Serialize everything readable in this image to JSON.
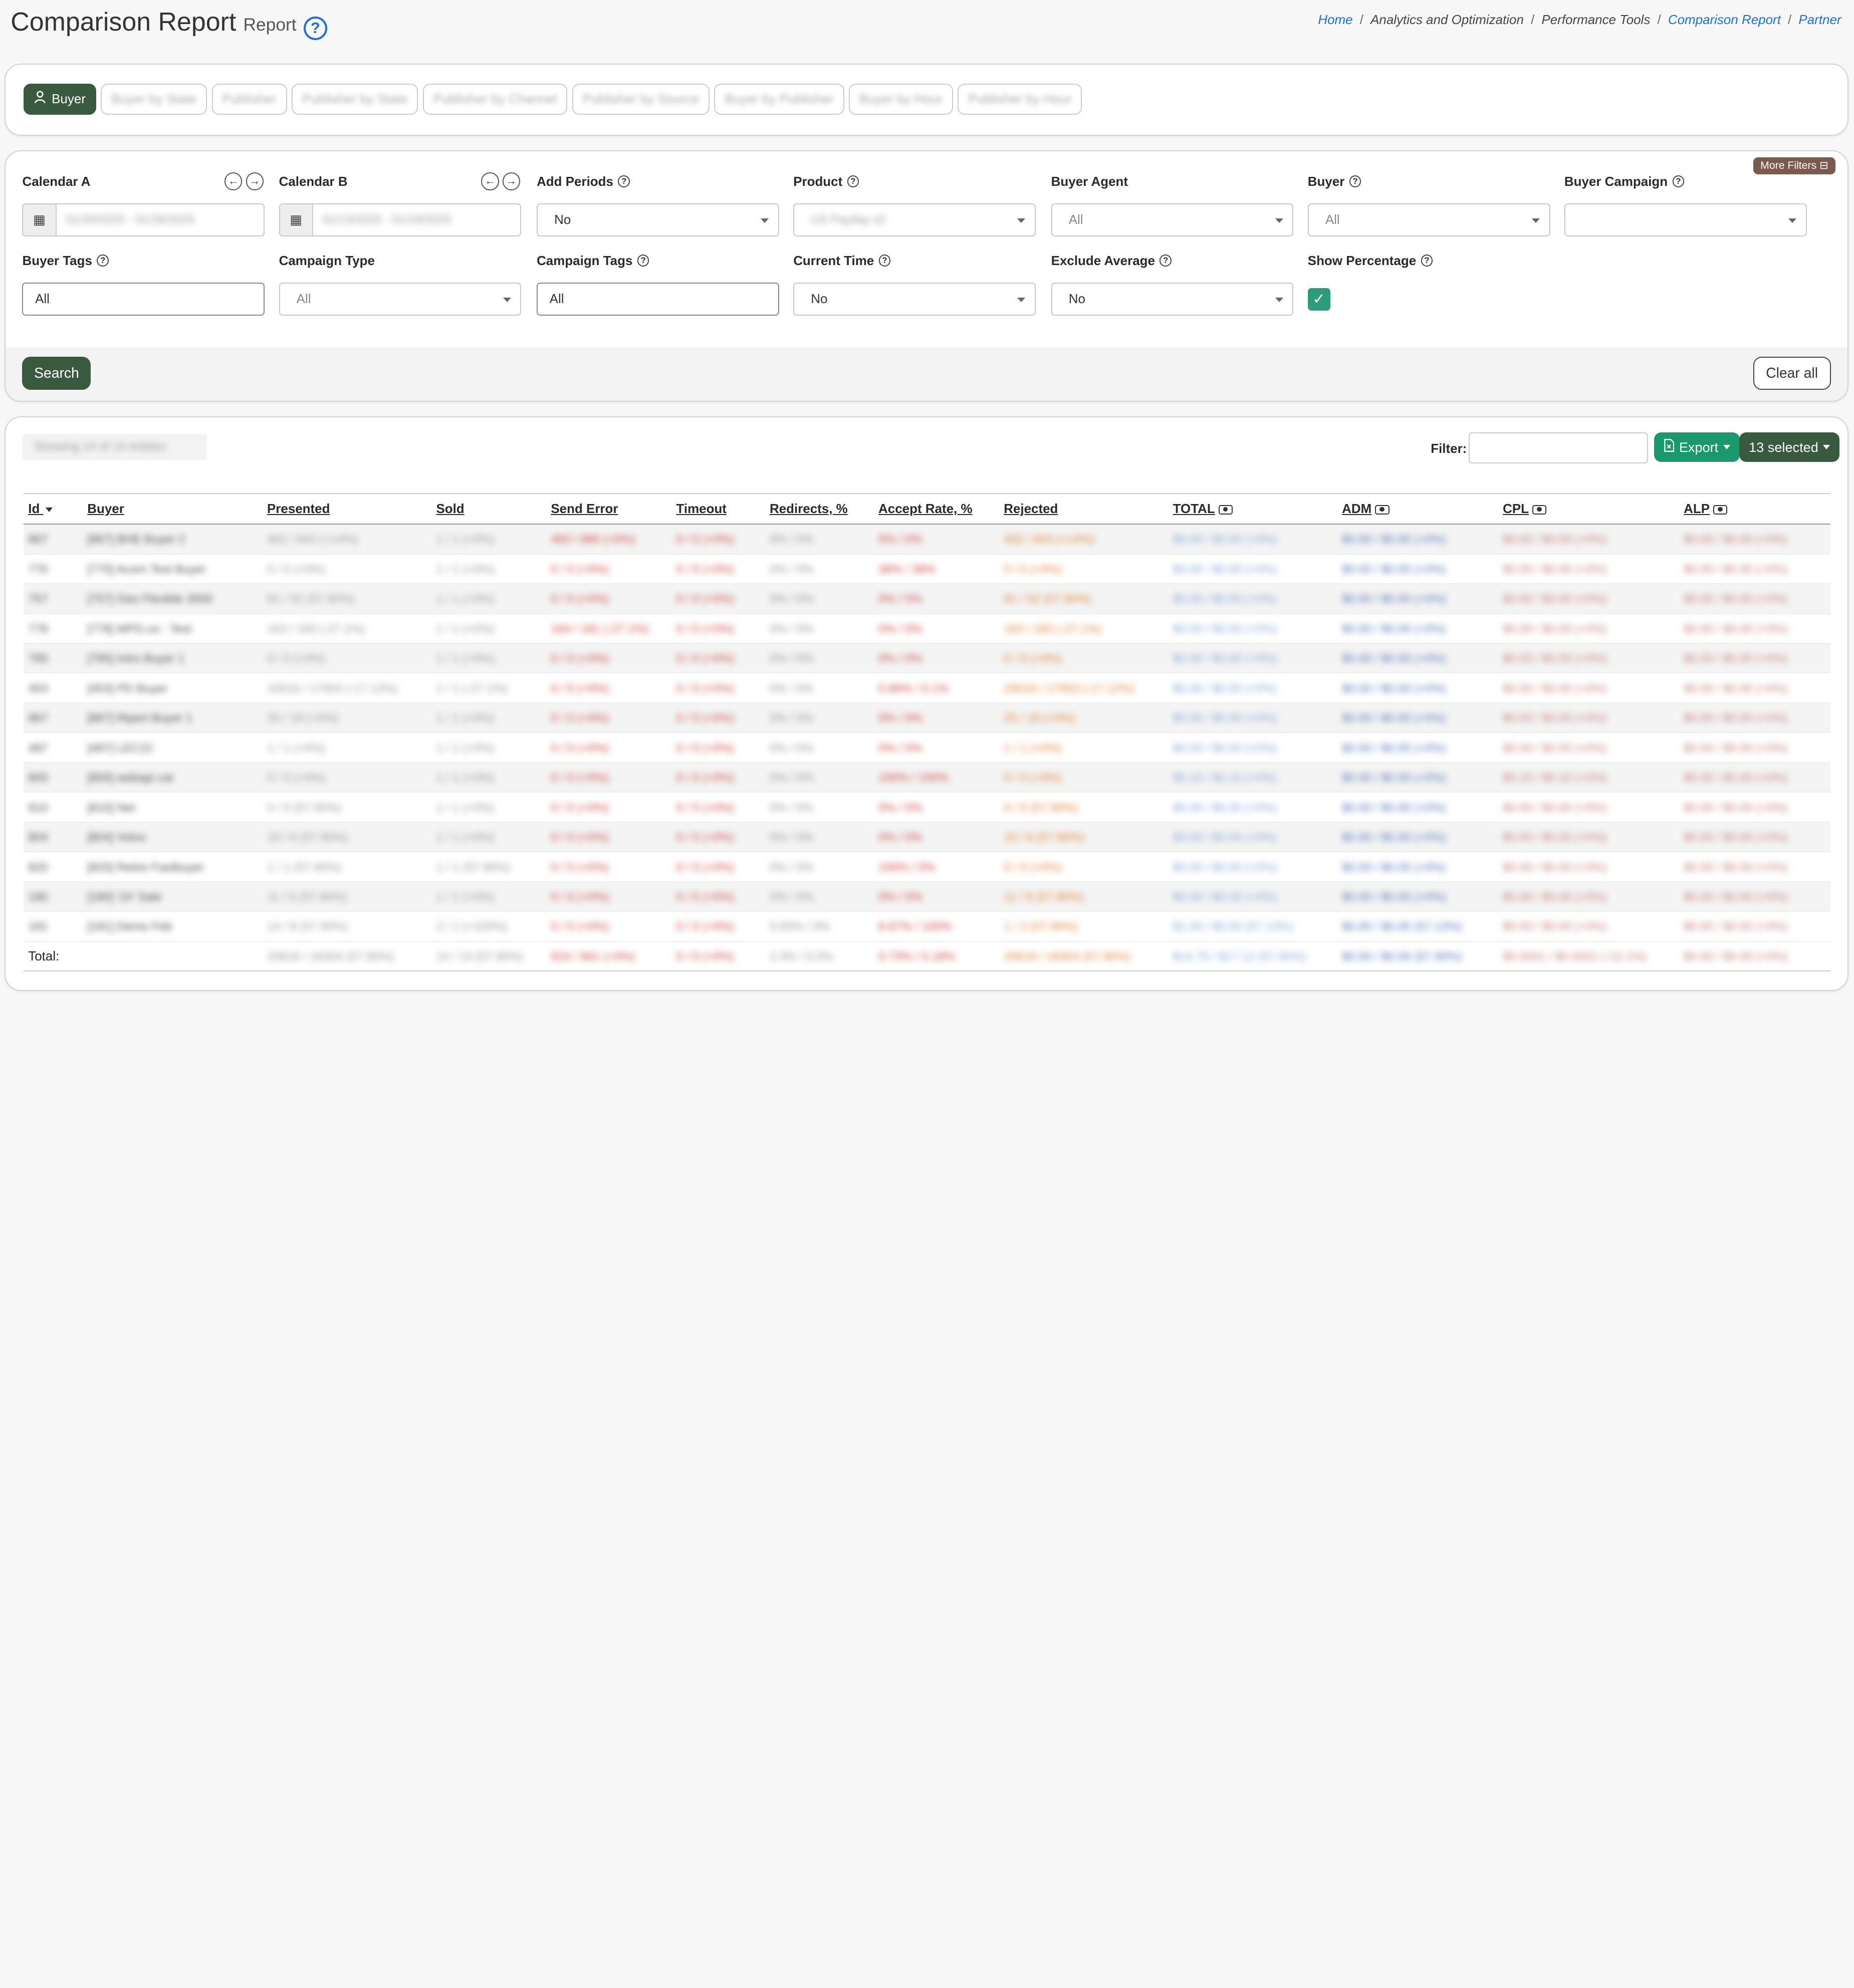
{
  "header": {
    "title": "Comparison Report",
    "subtitle": "Report",
    "help_glyph": "?"
  },
  "breadcrumb": {
    "items": [
      {
        "label": "Home",
        "link": true
      },
      {
        "label": "Analytics and Optimization",
        "link": false
      },
      {
        "label": "Performance Tools",
        "link": false
      },
      {
        "label": "Comparison Report",
        "link": true
      },
      {
        "label": "Partner",
        "link": true
      }
    ],
    "separator": "/"
  },
  "tabs": [
    {
      "label": "Buyer",
      "active": true,
      "icon": "user-icon"
    },
    {
      "label": "Buyer by State",
      "active": false
    },
    {
      "label": "Publisher",
      "active": false
    },
    {
      "label": "Publisher by State",
      "active": false
    },
    {
      "label": "Publisher by Channel",
      "active": false
    },
    {
      "label": "Publisher by Source",
      "active": false
    },
    {
      "label": "Buyer by Publisher",
      "active": false
    },
    {
      "label": "Buyer by Hour",
      "active": false
    },
    {
      "label": "Publisher by Hour",
      "active": false
    }
  ],
  "filters": {
    "more_filters": "More Filters",
    "calendar_a": {
      "label": "Calendar A",
      "value": "01/20/2025 - 01/26/2025"
    },
    "calendar_b": {
      "label": "Calendar B",
      "value": "01/13/2025 - 01/19/2025"
    },
    "add_periods": {
      "label": "Add Periods",
      "value": "No"
    },
    "product": {
      "label": "Product",
      "value": "US Payday v2"
    },
    "buyer_agent": {
      "label": "Buyer Agent",
      "value": "All"
    },
    "buyer": {
      "label": "Buyer",
      "value": "All"
    },
    "buyer_campaign": {
      "label": "Buyer Campaign",
      "value": ""
    },
    "buyer_tags": {
      "label": "Buyer Tags",
      "value": "All"
    },
    "campaign_type": {
      "label": "Campaign Type",
      "value": "All"
    },
    "campaign_tags": {
      "label": "Campaign Tags",
      "value": "All"
    },
    "current_time": {
      "label": "Current Time",
      "value": "No"
    },
    "exclude_average": {
      "label": "Exclude Average",
      "value": "No"
    },
    "show_percentage": {
      "label": "Show Percentage",
      "checked": true
    },
    "search_label": "Search",
    "clear_label": "Clear all"
  },
  "table_toolbar": {
    "showing": "Showing 14 of 14 entities",
    "filter_label": "Filter:",
    "export_label": "Export",
    "selected_label": "13 selected"
  },
  "table": {
    "columns": [
      "Id",
      "Buyer",
      "Presented",
      "Sold",
      "Send Error",
      "Timeout",
      "Redirects, %",
      "Accept Rate, %",
      "Rejected",
      "TOTAL",
      "ADM",
      "CPL",
      "ALP"
    ],
    "rows": [
      [
        "867",
        "[867] BHE Buyer 2",
        "462 / 843 (+14%)",
        "1 / 1 (+0%)",
        "460 / 880 (+0%)",
        "0 / 0 (+0%)",
        "0% / 0%",
        "0% / 0%",
        "452 / 843 (+14%)",
        "$0.00 / $0.00 (+0%)",
        "$0.00 / $0.00 (+0%)",
        "$0.00 / $0.00 (+0%)",
        "$0.00 / $0.00 (+0%)"
      ],
      [
        "770",
        "[770] Acorn Test Buyer",
        "0 / 0 (+0%)",
        "1 / 1 (+0%)",
        "0 / 0 (+0%)",
        "0 / 0 (+0%)",
        "0% / 0%",
        "38% / 38%",
        "0 / 0 (+0%)",
        "$0.00 / $0.00 (+0%)",
        "$0.00 / $0.00 (+0%)",
        "$0.00 / $0.00 (+0%)",
        "$0.00 / $0.00 (+0%)"
      ],
      [
        "757",
        "[757] Geo Flexible 3000",
        "81 / 52 (57.90%)",
        "1 / 1 (+0%)",
        "0 / 0 (+0%)",
        "0 / 0 (+0%)",
        "0% / 0%",
        "0% / 0%",
        "81 / 52 (57.90%)",
        "$0.00 / $0.00 (+0%)",
        "$0.00 / $0.00 (+0%)",
        "$0.00 / $0.00 (+0%)",
        "$0.00 / $0.00 (+0%)"
      ],
      [
        "778",
        "[778] MPG.co - Test",
        "163 / 183 (-27.1%)",
        "1 / 1 (+0%)",
        "164 / 181 (-27.1%)",
        "0 / 0 (+0%)",
        "0% / 0%",
        "0% / 0%",
        "163 / 183 (-27.1%)",
        "$0.00 / $0.00 (+0%)",
        "$0.00 / $0.00 (+0%)",
        "$0.00 / $0.00 (+0%)",
        "$0.00 / $0.00 (+0%)"
      ],
      [
        "785",
        "[785] Intro Buyer 1",
        "0 / 0 (+0%)",
        "1 / 1 (+0%)",
        "0 / 0 (+0%)",
        "0 / 0 (+0%)",
        "0% / 0%",
        "0% / 0%",
        "0 / 0 (+0%)",
        "$0.00 / $0.00 (+0%)",
        "$0.00 / $0.00 (+0%)",
        "$0.00 / $0.00 (+0%)",
        "$0.00 / $0.00 (+0%)"
      ],
      [
        "453",
        "[453] PD Buyer",
        "20016 / 17003 (-17.12%)",
        "1 / 1 (-27.1%)",
        "0 / 0 (+0%)",
        "0 / 0 (+0%)",
        "0% / 0%",
        "0.86% / 0.1%",
        "20016 / 17003 (-17.12%)",
        "$0.00 / $0.00 (+0%)",
        "$0.00 / $0.00 (+0%)",
        "$0.00 / $0.00 (+0%)",
        "$0.00 / $0.00 (+0%)"
      ],
      [
        "867",
        "[867] Ripert Buyer 1",
        "25 / 18 (+0%)",
        "1 / 1 (+0%)",
        "0 / 0 (+0%)",
        "0 / 0 (+0%)",
        "0% / 0%",
        "0% / 0%",
        "25 / 18 (+0%)",
        "$0.00 / $0.00 (+0%)",
        "$0.00 / $0.00 (+0%)",
        "$0.00 / $0.00 (+0%)",
        "$0.00 / $0.00 (+0%)"
      ],
      [
        "487",
        "[487] LEC22",
        "1 / 1 (+0%)",
        "1 / 1 (+0%)",
        "0 / 0 (+0%)",
        "0 / 0 (+0%)",
        "0% / 0%",
        "0% / 0%",
        "1 / 1 (+0%)",
        "$0.00 / $0.00 (+0%)",
        "$0.00 / $0.00 (+0%)",
        "$0.00 / $0.00 (+0%)",
        "$0.00 / $0.00 (+0%)"
      ],
      [
        "800",
        "[800] webapi cat",
        "0 / 0 (+0%)",
        "1 / 1 (+0%)",
        "0 / 0 (+0%)",
        "0 / 0 (+0%)",
        "0% / 0%",
        "100% / 100%",
        "0 / 0 (+0%)",
        "$0.10 / $0.10 (+0%)",
        "$0.00 / $0.00 (+0%)",
        "$0.10 / $0.10 (+0%)",
        "$0.00 / $0.00 (+0%)"
      ],
      [
        "810",
        "[810] Net",
        "0 / 0 (57.90%)",
        "1 / 1 (+0%)",
        "0 / 0 (+0%)",
        "0 / 0 (+0%)",
        "0% / 0%",
        "0% / 0%",
        "0 / 0 (57.90%)",
        "$0.00 / $0.00 (+0%)",
        "$0.00 / $0.00 (+0%)",
        "$0.00 / $0.00 (+0%)",
        "$0.00 / $0.00 (+0%)"
      ],
      [
        "804",
        "[804] Volvo",
        "10 / 6 (57.90%)",
        "1 / 1 (+0%)",
        "0 / 0 (+0%)",
        "0 / 0 (+0%)",
        "0% / 0%",
        "0% / 0%",
        "10 / 6 (57.90%)",
        "$0.00 / $0.00 (+0%)",
        "$0.00 / $0.00 (+0%)",
        "$0.00 / $0.00 (+0%)",
        "$0.00 / $0.00 (+0%)"
      ],
      [
        "820",
        "[820] Retire Fastbuyer",
        "1 / 1 (57.90%)",
        "1 / 1 (57.90%)",
        "0 / 0 (+0%)",
        "0 / 0 (+0%)",
        "0% / 0%",
        "100% / 0%",
        "0 / 0 (+0%)",
        "$0.00 / $0.00 (+0%)",
        "$0.00 / $0.00 (+0%)",
        "$0.00 / $0.00 (+0%)",
        "$0.00 / $0.00 (+0%)"
      ],
      [
        "180",
        "[180] '24' Sale",
        "11 / 9 (57.90%)",
        "1 / 1 (+0%)",
        "0 / 0 (+0%)",
        "0 / 0 (+0%)",
        "0% / 0%",
        "0% / 0%",
        "11 / 9 (57.90%)",
        "$0.00 / $0.00 (+0%)",
        "$0.00 / $0.00 (+0%)",
        "$0.00 / $0.00 (+0%)",
        "$0.00 / $0.00 (+0%)"
      ],
      [
        "181",
        "[181] Demo Feb",
        "14 / 8 (57.90%)",
        "2 / 1 (+100%)",
        "0 / 0 (+0%)",
        "0 / 0 (+0%)",
        "0.00% / 0%",
        "8.67% / 100%",
        "1 / 2 (57.90%)",
        "$1.00 / $0.00 (57.13%)",
        "$0.00 / $0.00 (57.13%)",
        "$0.00 / $0.00 (+0%)",
        "$0.00 / $0.00 (+0%)"
      ]
    ],
    "total": {
      "label": "Total:",
      "values": [
        "20616 / 18304 (57.90%)",
        "14 / 13 (57.90%)",
        "624 / 661 (+0%)",
        "0 / 0 (+0%)",
        "2.3% / 0.0%",
        "0.73% / 0.18%",
        "20616 / 18304 (57.90%)",
        "$14.75 / $17.12 (57.90%)",
        "$0.00 / $0.00 (57.90%)",
        "$0.0001 / $0.0001 (-12.1%)",
        "$0.00 / $0.00 (+0%)"
      ]
    }
  },
  "colors": {
    "primary": "#3a5a40",
    "export": "#1a9a6c",
    "link": "#1e6fd9",
    "more_filters": "#7a5a4e"
  }
}
